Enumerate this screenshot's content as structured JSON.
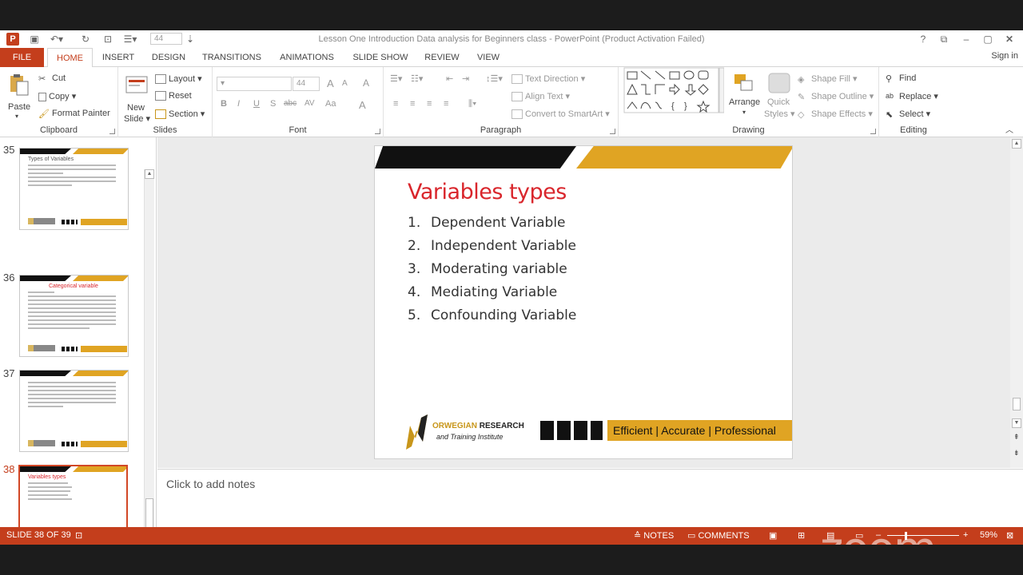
{
  "window": {
    "title": "Lesson One Introduction Data analysis for Beginners class - PowerPoint (Product Activation Failed)",
    "font_size_qat": "44",
    "help": "?",
    "restore": "⧉",
    "minimize": "–",
    "maximize": "▢",
    "close": "✕"
  },
  "tabs": {
    "file": "FILE",
    "items": [
      "HOME",
      "INSERT",
      "DESIGN",
      "TRANSITIONS",
      "ANIMATIONS",
      "SLIDE SHOW",
      "REVIEW",
      "VIEW"
    ],
    "sign_in": "Sign in"
  },
  "ribbon": {
    "clipboard": {
      "label": "Clipboard",
      "paste": "Paste",
      "cut": "Cut",
      "copy": "Copy",
      "format_painter": "Format Painter"
    },
    "slides": {
      "label": "Slides",
      "new_slide_1": "New",
      "new_slide_2": "Slide",
      "layout": "Layout",
      "reset": "Reset",
      "section": "Section"
    },
    "font": {
      "label": "Font",
      "size": "44",
      "bold": "B",
      "italic": "I",
      "underline": "U",
      "shadow": "S",
      "strike": "abc",
      "spacing": "AV",
      "case": "Aa",
      "color": "A",
      "grow": "A",
      "shrink": "A",
      "clear": "A"
    },
    "paragraph": {
      "label": "Paragraph",
      "text_direction": "Text Direction",
      "align_text": "Align Text",
      "convert_smartart": "Convert to SmartArt"
    },
    "drawing": {
      "label": "Drawing",
      "arrange": "Arrange",
      "quick_styles_1": "Quick",
      "quick_styles_2": "Styles",
      "shape_fill": "Shape Fill",
      "shape_outline": "Shape Outline",
      "shape_effects": "Shape Effects"
    },
    "editing": {
      "label": "Editing",
      "find": "Find",
      "replace": "Replace",
      "select": "Select"
    }
  },
  "thumbnails": [
    {
      "num": "35",
      "title": "Types of Variables"
    },
    {
      "num": "36",
      "title": "Categorical variable"
    },
    {
      "num": "37",
      "title": ""
    },
    {
      "num": "38",
      "title": "Variables types"
    }
  ],
  "slide": {
    "title": "Variables types",
    "items": [
      {
        "num": "1.",
        "text": "Dependent Variable"
      },
      {
        "num": "2.",
        "text": "Independent Variable"
      },
      {
        "num": "3.",
        "text": "Moderating variable"
      },
      {
        "num": "4.",
        "text": "Mediating Variable"
      },
      {
        "num": "5.",
        "text": "Confounding Variable"
      }
    ],
    "logo_line1a": "ORWEGIAN",
    "logo_line1b": " RESEARCH",
    "logo_line2": "and Training Institute",
    "slogan": "Efficient | Accurate | Professional"
  },
  "notes": {
    "placeholder": "Click to add notes"
  },
  "status": {
    "slide_count": "SLIDE 38 OF 39",
    "notes": "NOTES",
    "comments": "COMMENTS",
    "zoom": "59%"
  },
  "watermark": "zoom",
  "colors": {
    "accent": "#c43e1c",
    "gold": "#e0a423",
    "title_red": "#d9262c"
  }
}
